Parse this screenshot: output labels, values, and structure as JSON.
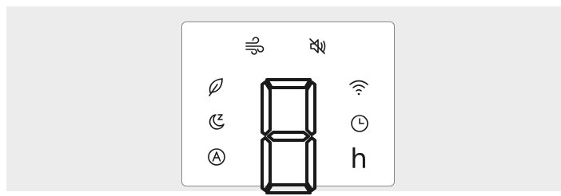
{
  "display_panel": {
    "digit_value": "8",
    "hours_unit": "h",
    "icons": [
      "fan-speed-icon",
      "mute-icon",
      "eco-leaf-icon",
      "sleep-mode-icon",
      "auto-mode-icon",
      "wifi-icon",
      "timer-clock-icon"
    ]
  },
  "colors": {
    "panel_background": "#ececec",
    "display_background": "#ffffff",
    "segment": "#1a1a1a",
    "border": "#8a8a8a"
  }
}
